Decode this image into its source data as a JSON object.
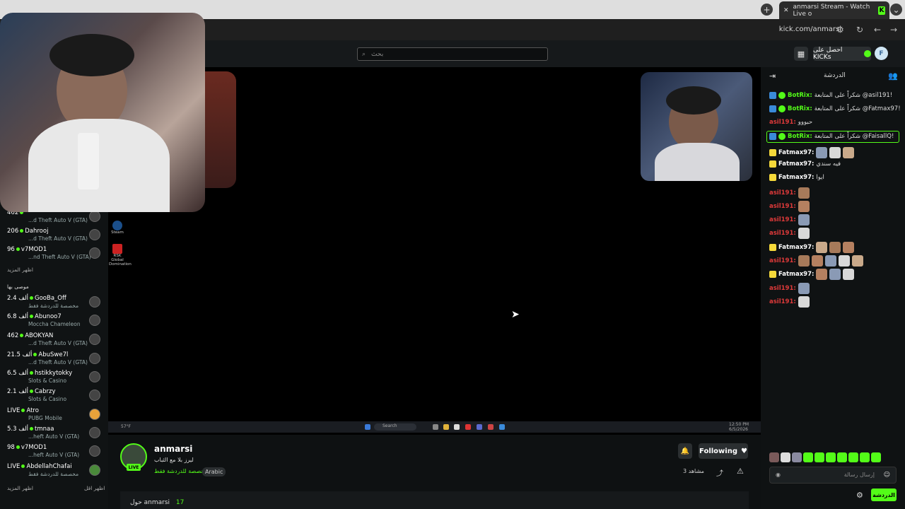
{
  "browser": {
    "tab_title": "anmarsi Stream - Watch Live o",
    "tab_icon": "kick-favicon",
    "url": "kick.com/anmarsi"
  },
  "header": {
    "search_placeholder": "بحث",
    "get_kicks": "احصل على KICKs",
    "profile_initial": "F"
  },
  "sidebar": {
    "channels_top": [
      {
        "count": "462",
        "name": "",
        "game": "...d Theft Auto V (GTA)"
      },
      {
        "count": "206",
        "name": "Dahrooj",
        "game": "...d Theft Auto V (GTA)"
      },
      {
        "count": "96",
        "name": "v7MOD1",
        "game": "...nd Theft Auto V (GTA)"
      }
    ],
    "show_more_1": "اظهر المزيد",
    "recommended_title": "موصى بها",
    "recommended": [
      {
        "count": "2.4 ألف",
        "name": "GooBa_Off",
        "game": "مخصصة للدردشة فقط"
      },
      {
        "count": "6.8 ألف",
        "name": "Abunoo7",
        "game": "Moccha Chameleon"
      },
      {
        "count": "462",
        "name": "ABOKYAN",
        "game": "...d Theft Auto V (GTA)"
      },
      {
        "count": "21.5 ألف",
        "name": "AbuSwe7l",
        "game": "...d Theft Auto V (GTA)"
      },
      {
        "count": "6.5 ألف",
        "name": "hstikkytokky",
        "game": "Slots & Casino"
      },
      {
        "count": "2.1 ألف",
        "name": "Cabrzy",
        "game": "Slots & Casino"
      },
      {
        "count": "LIVE",
        "name": "Atro",
        "game": "PUBG Mobile"
      },
      {
        "count": "5.3 ألف",
        "name": "tmnaa",
        "game": "...heft Auto V (GTA)"
      },
      {
        "count": "98",
        "name": "v7MOD1",
        "game": "...heft Auto V (GTA)"
      },
      {
        "count": "LIVE",
        "name": "AbdellahChafai",
        "game": "مخصصة للدردشة فقط"
      }
    ],
    "show_more_2": "اظهر المزيد",
    "show_less": "اظهر اقل"
  },
  "video": {
    "desktop_icons": [
      "Steam",
      "RSK Global Domination"
    ],
    "taskbar_search": "Search",
    "taskbar_weather": "57°F",
    "taskbar_time": "12:50 PM",
    "taskbar_date": "6/5/2026"
  },
  "stream": {
    "streamer": "anmarsi",
    "live_badge": "LIVE",
    "title": "ليرز بلا مع الثباب",
    "category": "مخصصة للدردشة فقط",
    "language": "Arabic",
    "follow_label": "Following",
    "viewers": "3 مشاهد",
    "about_streamer": "حول anmarsi",
    "about_followers": "17"
  },
  "chat": {
    "title": "الدردشة",
    "messages": [
      {
        "user": "BotRix",
        "color": "#53fc18",
        "text": "شكراً على المتابعة @asil191!",
        "verified": true
      },
      {
        "user": "BotRix",
        "color": "#53fc18",
        "text": "شكراً على المتابعة @Fatmax97!",
        "verified": true
      },
      {
        "user": "asil191",
        "color": "#e03a3a",
        "text": "حبووو"
      },
      {
        "user": "BotRix",
        "color": "#53fc18",
        "text": "شكراً على المتابعة @FaisallQ!",
        "verified": true
      },
      {
        "user": "Fatmax97",
        "color": "#ffffff",
        "text": "",
        "emotes": 3
      },
      {
        "user": "Fatmax97",
        "color": "#ffffff",
        "text": "فيه سندي"
      },
      {
        "user": "Fatmax97",
        "color": "#ffffff",
        "text": "ايوا"
      },
      {
        "user": "asil191",
        "color": "#e03a3a",
        "text": "",
        "emotes": 1
      },
      {
        "user": "asil191",
        "color": "#e03a3a",
        "text": "",
        "emotes": 1
      },
      {
        "user": "asil191",
        "color": "#e03a3a",
        "text": "",
        "emotes": 1
      },
      {
        "user": "asil191",
        "color": "#e03a3a",
        "text": "",
        "emotes": 1
      },
      {
        "user": "Fatmax97",
        "color": "#ffffff",
        "text": "",
        "emotes": 3
      },
      {
        "user": "asil191",
        "color": "#e03a3a",
        "text": "",
        "emotes": 5
      },
      {
        "user": "Fatmax97",
        "color": "#ffffff",
        "text": "",
        "emotes": 3
      },
      {
        "user": "asil191",
        "color": "#e03a3a",
        "text": "",
        "emotes": 1
      },
      {
        "user": "asil191",
        "color": "#e03a3a",
        "text": "",
        "emotes": 1
      }
    ],
    "input_placeholder": "إرسال رسالة",
    "send_label": "الدردشة"
  },
  "colors": {
    "accent": "#53fc18",
    "bg": "#0b0e0f"
  }
}
